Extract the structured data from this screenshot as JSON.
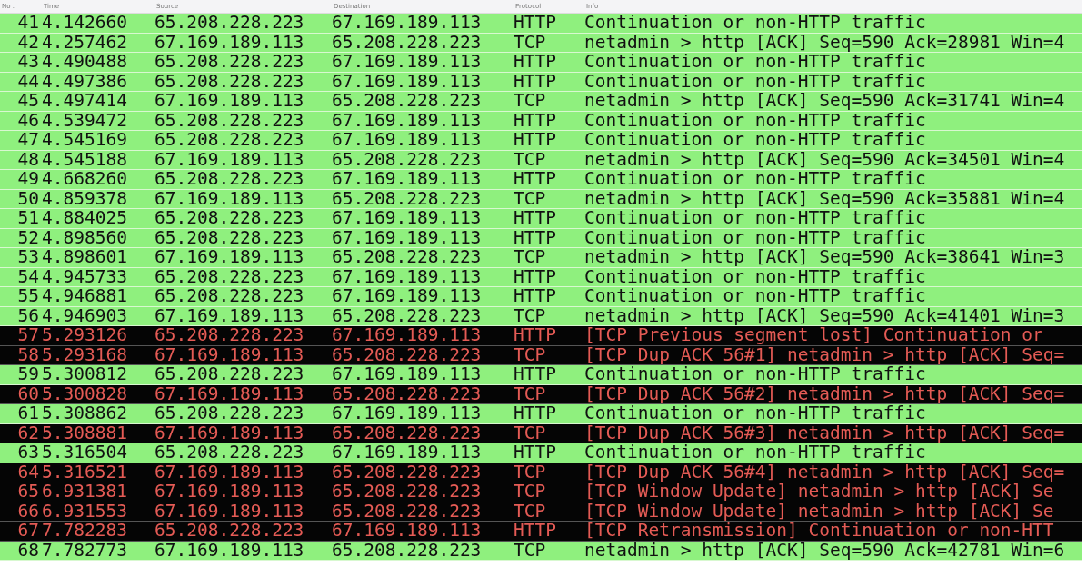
{
  "columns": [
    "No .",
    "Time",
    "Source",
    "Destination",
    "Protocol",
    "Info"
  ],
  "rows": [
    {
      "no": "41",
      "time": "4.142660",
      "source": "65.208.228.223",
      "destination": "67.169.189.113",
      "protocol": "HTTP",
      "info": "Continuation or non-HTTP traffic",
      "kind": "normal"
    },
    {
      "no": "42",
      "time": "4.257462",
      "source": "67.169.189.113",
      "destination": "65.208.228.223",
      "protocol": "TCP",
      "info": "netadmin > http [ACK] Seq=590 Ack=28981 Win=4",
      "kind": "normal"
    },
    {
      "no": "43",
      "time": "4.490488",
      "source": "65.208.228.223",
      "destination": "67.169.189.113",
      "protocol": "HTTP",
      "info": "Continuation or non-HTTP traffic",
      "kind": "normal"
    },
    {
      "no": "44",
      "time": "4.497386",
      "source": "65.208.228.223",
      "destination": "67.169.189.113",
      "protocol": "HTTP",
      "info": "Continuation or non-HTTP traffic",
      "kind": "normal"
    },
    {
      "no": "45",
      "time": "4.497414",
      "source": "67.169.189.113",
      "destination": "65.208.228.223",
      "protocol": "TCP",
      "info": "netadmin > http [ACK] Seq=590 Ack=31741 Win=4",
      "kind": "normal"
    },
    {
      "no": "46",
      "time": "4.539472",
      "source": "65.208.228.223",
      "destination": "67.169.189.113",
      "protocol": "HTTP",
      "info": "Continuation or non-HTTP traffic",
      "kind": "normal"
    },
    {
      "no": "47",
      "time": "4.545169",
      "source": "65.208.228.223",
      "destination": "67.169.189.113",
      "protocol": "HTTP",
      "info": "Continuation or non-HTTP traffic",
      "kind": "normal"
    },
    {
      "no": "48",
      "time": "4.545188",
      "source": "67.169.189.113",
      "destination": "65.208.228.223",
      "protocol": "TCP",
      "info": "netadmin > http [ACK] Seq=590 Ack=34501 Win=4",
      "kind": "normal"
    },
    {
      "no": "49",
      "time": "4.668260",
      "source": "65.208.228.223",
      "destination": "67.169.189.113",
      "protocol": "HTTP",
      "info": "Continuation or non-HTTP traffic",
      "kind": "normal"
    },
    {
      "no": "50",
      "time": "4.859378",
      "source": "67.169.189.113",
      "destination": "65.208.228.223",
      "protocol": "TCP",
      "info": "netadmin > http [ACK] Seq=590 Ack=35881 Win=4",
      "kind": "normal"
    },
    {
      "no": "51",
      "time": "4.884025",
      "source": "65.208.228.223",
      "destination": "67.169.189.113",
      "protocol": "HTTP",
      "info": "Continuation or non-HTTP traffic",
      "kind": "normal"
    },
    {
      "no": "52",
      "time": "4.898560",
      "source": "65.208.228.223",
      "destination": "67.169.189.113",
      "protocol": "HTTP",
      "info": "Continuation or non-HTTP traffic",
      "kind": "normal"
    },
    {
      "no": "53",
      "time": "4.898601",
      "source": "67.169.189.113",
      "destination": "65.208.228.223",
      "protocol": "TCP",
      "info": "netadmin > http [ACK] Seq=590 Ack=38641 Win=3",
      "kind": "normal"
    },
    {
      "no": "54",
      "time": "4.945733",
      "source": "65.208.228.223",
      "destination": "67.169.189.113",
      "protocol": "HTTP",
      "info": "Continuation or non-HTTP traffic",
      "kind": "normal"
    },
    {
      "no": "55",
      "time": "4.946881",
      "source": "65.208.228.223",
      "destination": "67.169.189.113",
      "protocol": "HTTP",
      "info": "Continuation or non-HTTP traffic",
      "kind": "normal"
    },
    {
      "no": "56",
      "time": "4.946903",
      "source": "67.169.189.113",
      "destination": "65.208.228.223",
      "protocol": "TCP",
      "info": "netadmin > http [ACK] Seq=590 Ack=41401 Win=3",
      "kind": "normal"
    },
    {
      "no": "57",
      "time": "5.293126",
      "source": "65.208.228.223",
      "destination": "67.169.189.113",
      "protocol": "HTTP",
      "info": "[TCP Previous segment lost] Continuation or",
      "kind": "error"
    },
    {
      "no": "58",
      "time": "5.293168",
      "source": "67.169.189.113",
      "destination": "65.208.228.223",
      "protocol": "TCP",
      "info": "[TCP Dup ACK 56#1] netadmin > http [ACK] Seq=",
      "kind": "error"
    },
    {
      "no": "59",
      "time": "5.300812",
      "source": "65.208.228.223",
      "destination": "67.169.189.113",
      "protocol": "HTTP",
      "info": "Continuation or non-HTTP traffic",
      "kind": "normal"
    },
    {
      "no": "60",
      "time": "5.300828",
      "source": "67.169.189.113",
      "destination": "65.208.228.223",
      "protocol": "TCP",
      "info": "[TCP Dup ACK 56#2] netadmin > http [ACK] Seq=",
      "kind": "error"
    },
    {
      "no": "61",
      "time": "5.308862",
      "source": "65.208.228.223",
      "destination": "67.169.189.113",
      "protocol": "HTTP",
      "info": "Continuation or non-HTTP traffic",
      "kind": "normal"
    },
    {
      "no": "62",
      "time": "5.308881",
      "source": "67.169.189.113",
      "destination": "65.208.228.223",
      "protocol": "TCP",
      "info": "[TCP Dup ACK 56#3] netadmin > http [ACK] Seq=",
      "kind": "error"
    },
    {
      "no": "63",
      "time": "5.316504",
      "source": "65.208.228.223",
      "destination": "67.169.189.113",
      "protocol": "HTTP",
      "info": "Continuation or non-HTTP traffic",
      "kind": "normal"
    },
    {
      "no": "64",
      "time": "5.316521",
      "source": "67.169.189.113",
      "destination": "65.208.228.223",
      "protocol": "TCP",
      "info": "[TCP Dup ACK 56#4] netadmin > http [ACK] Seq=",
      "kind": "error"
    },
    {
      "no": "65",
      "time": "6.931381",
      "source": "67.169.189.113",
      "destination": "65.208.228.223",
      "protocol": "TCP",
      "info": "[TCP Window Update] netadmin > http [ACK] Se",
      "kind": "error"
    },
    {
      "no": "66",
      "time": "6.931553",
      "source": "67.169.189.113",
      "destination": "65.208.228.223",
      "protocol": "TCP",
      "info": "[TCP Window Update] netadmin > http [ACK] Se",
      "kind": "error"
    },
    {
      "no": "67",
      "time": "7.782283",
      "source": "65.208.228.223",
      "destination": "67.169.189.113",
      "protocol": "HTTP",
      "info": "[TCP Retransmission] Continuation or non-HTT",
      "kind": "error"
    },
    {
      "no": "68",
      "time": "7.782773",
      "source": "67.169.189.113",
      "destination": "65.208.228.223",
      "protocol": "TCP",
      "info": "netadmin > http [ACK] Seq=590 Ack=42781 Win=6",
      "kind": "normal"
    }
  ]
}
